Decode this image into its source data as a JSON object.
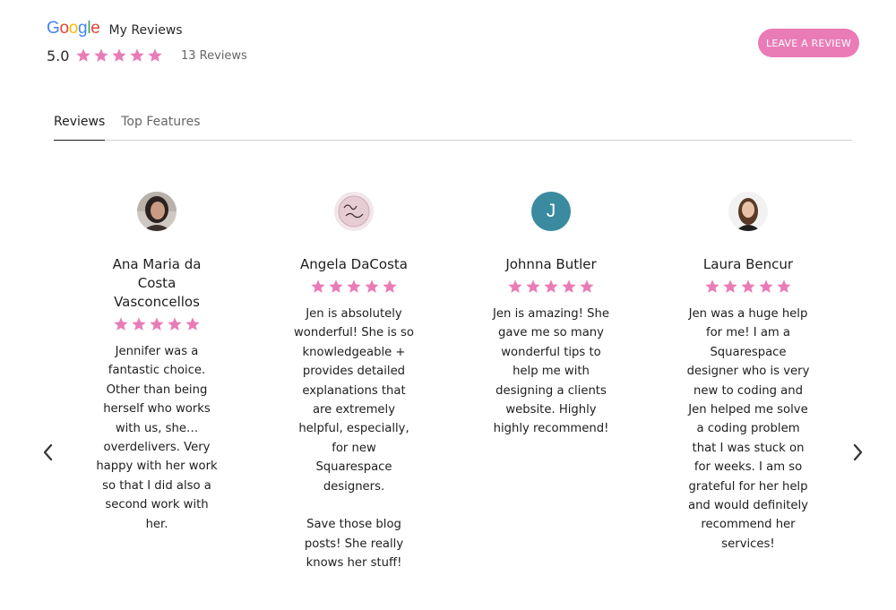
{
  "header": {
    "google_letters": [
      {
        "char": "G",
        "color": "#4285F4"
      },
      {
        "char": "o",
        "color": "#EA4335"
      },
      {
        "char": "o",
        "color": "#FBBC05"
      },
      {
        "char": "g",
        "color": "#4285F4"
      },
      {
        "char": "l",
        "color": "#34A853"
      },
      {
        "char": "e",
        "color": "#EA4335"
      }
    ],
    "title": "My Reviews",
    "rating": "5.0",
    "stars": 5,
    "review_count": "13 Reviews",
    "leave_review_label": "LEAVE A REVIEW"
  },
  "tabs": [
    {
      "label": "Reviews",
      "active": true
    },
    {
      "label": "Top Features",
      "active": false
    }
  ],
  "colors": {
    "star": "#e97cb7",
    "accent": "#e97cb7",
    "avatar_j": "#3a8aa0"
  },
  "reviews": [
    {
      "name": "Ana Maria da\nCosta\nVasconcellos",
      "stars": 5,
      "avatar": "photo",
      "text": "Jennifer was a\nfantastic choice.\nOther than being\nherself who works\nwith us, she…\noverdelivers. Very\nhappy with her work\nso that I did also a\nsecond work with\nher."
    },
    {
      "name": "Angela DaCosta",
      "stars": 5,
      "avatar": "logo",
      "text": "Jen is absolutely\nwonderful! She is so\nknowledgeable +\nprovides detailed\nexplanations that\nare extremely\nhelpful, especially,\nfor new\nSquarespace\ndesigners.\n\nSave those blog\nposts! She really\nknows her stuff!"
    },
    {
      "name": "Johnna Butler",
      "stars": 5,
      "avatar": "letter",
      "avatar_letter": "J",
      "text": "Jen is amazing! She\ngave me so many\nwonderful tips to\nhelp me with\ndesigning a clients\nwebsite. Highly\nhighly recommend!"
    },
    {
      "name": "Laura Bencur",
      "stars": 5,
      "avatar": "photo",
      "text": "Jen was a huge help\nfor me! I am a\nSquarespace\ndesigner who is very\nnew to coding and\nJen helped me solve\na coding problem\nthat I was stuck on\nfor weeks. I am so\ngrateful for her help\nand would definitely\nrecommend her\nservices!"
    }
  ],
  "icons": {
    "prev": "chevron-left-icon",
    "next": "chevron-right-icon",
    "star": "star-icon"
  }
}
